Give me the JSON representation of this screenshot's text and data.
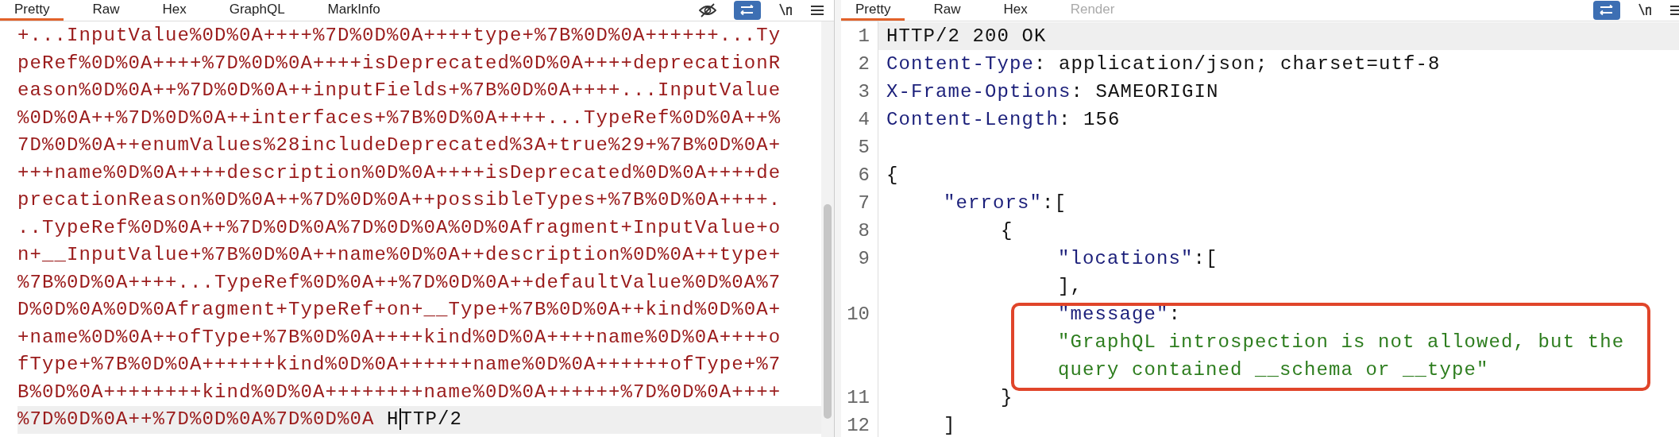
{
  "request_pane": {
    "tabs": [
      {
        "label": "Pretty",
        "selected": true
      },
      {
        "label": "Raw",
        "selected": false
      },
      {
        "label": "Hex",
        "selected": false
      },
      {
        "label": "GraphQL",
        "selected": false
      },
      {
        "label": "MarkInfo",
        "selected": false
      }
    ],
    "toolbar": {
      "wrap_on": true
    },
    "lines": [
      {
        "tokens": [
          {
            "kind": "encoded",
            "text": "+...InputValue%0D%0A++++%7D%0D%0A++++type+%7B%0D%0A++++++...Ty"
          }
        ]
      },
      {
        "tokens": [
          {
            "kind": "encoded",
            "text": "peRef%0D%0A++++%7D%0D%0A++++isDeprecated%0D%0A++++deprecationR"
          }
        ]
      },
      {
        "tokens": [
          {
            "kind": "encoded",
            "text": "eason%0D%0A++%7D%0D%0A++inputFields+%7B%0D%0A++++...InputValue"
          }
        ]
      },
      {
        "tokens": [
          {
            "kind": "encoded",
            "text": "%0D%0A++%7D%0D%0A++interfaces+%7B%0D%0A++++...TypeRef%0D%0A++%"
          }
        ]
      },
      {
        "tokens": [
          {
            "kind": "encoded",
            "text": "7D%0D%0A++enumValues%28includeDeprecated%3A+true%29+%7B%0D%0A+"
          }
        ]
      },
      {
        "tokens": [
          {
            "kind": "encoded",
            "text": "+++name%0D%0A++++description%0D%0A++++isDeprecated%0D%0A++++de"
          }
        ]
      },
      {
        "tokens": [
          {
            "kind": "encoded",
            "text": "precationReason%0D%0A++%7D%0D%0A++possibleTypes+%7B%0D%0A++++."
          }
        ]
      },
      {
        "tokens": [
          {
            "kind": "encoded",
            "text": "..TypeRef%0D%0A++%7D%0D%0A%7D%0D%0A%0D%0Afragment+InputValue+o"
          }
        ]
      },
      {
        "tokens": [
          {
            "kind": "encoded",
            "text": "n+__InputValue+%7B%0D%0A++name%0D%0A++description%0D%0A++type+"
          }
        ]
      },
      {
        "tokens": [
          {
            "kind": "encoded",
            "text": "%7B%0D%0A++++...TypeRef%0D%0A++%7D%0D%0A++defaultValue%0D%0A%7"
          }
        ]
      },
      {
        "tokens": [
          {
            "kind": "encoded",
            "text": "D%0D%0A%0D%0Afragment+TypeRef+on+__Type+%7B%0D%0A++kind%0D%0A+"
          }
        ]
      },
      {
        "tokens": [
          {
            "kind": "encoded",
            "text": "+name%0D%0A++ofType+%7B%0D%0A++++kind%0D%0A++++name%0D%0A++++o"
          }
        ]
      },
      {
        "tokens": [
          {
            "kind": "encoded",
            "text": "fType+%7B%0D%0A++++++kind%0D%0A++++++name%0D%0A++++++ofType+%7"
          }
        ]
      },
      {
        "tokens": [
          {
            "kind": "encoded",
            "text": "B%0D%0A++++++++kind%0D%0A++++++++name%0D%0A++++++%7D%0D%0A++++"
          }
        ]
      },
      {
        "highlighted": true,
        "tokens": [
          {
            "kind": "encoded",
            "text": "%7D%0D%0A++%7D%0D%0A%7D%0D%0A"
          },
          {
            "kind": "plain",
            "text": " H"
          },
          {
            "kind": "plain",
            "text": "TTP/2",
            "cursor_before": true
          }
        ]
      }
    ]
  },
  "response_pane": {
    "tabs": [
      {
        "label": "Pretty",
        "selected": true,
        "disabled": false
      },
      {
        "label": "Raw",
        "selected": false,
        "disabled": false
      },
      {
        "label": "Hex",
        "selected": false,
        "disabled": false
      },
      {
        "label": "Render",
        "selected": false,
        "disabled": true
      }
    ],
    "toolbar": {
      "wrap_on": true
    },
    "lines": [
      {
        "number": "1",
        "highlighted": true,
        "tokens": [
          {
            "kind": "plain",
            "text": "HTTP/2 200 OK"
          }
        ]
      },
      {
        "number": "2",
        "tokens": [
          {
            "kind": "key",
            "text": "Content-Type"
          },
          {
            "kind": "plain",
            "text": ": application/json; charset=utf-8"
          }
        ]
      },
      {
        "number": "3",
        "tokens": [
          {
            "kind": "key",
            "text": "X-Frame-Options"
          },
          {
            "kind": "plain",
            "text": ": SAMEORIGIN"
          }
        ]
      },
      {
        "number": "4",
        "tokens": [
          {
            "kind": "key",
            "text": "Content-Length"
          },
          {
            "kind": "plain",
            "text": ": 156"
          }
        ]
      },
      {
        "number": "5"
      },
      {
        "number": "6",
        "tokens": [
          {
            "kind": "plain",
            "text": "{"
          }
        ],
        "children": [
          {
            "number": "7",
            "tokens": [
              {
                "kind": "key",
                "text": "\"errors\""
              },
              {
                "kind": "plain",
                "text": ":["
              }
            ],
            "children": [
              {
                "number": "8",
                "tokens": [
                  {
                    "kind": "plain",
                    "text": "{"
                  }
                ],
                "children": [
                  {
                    "number": "9",
                    "tokens": [
                      {
                        "kind": "key",
                        "text": "\"locations\""
                      },
                      {
                        "kind": "plain",
                        "text": ":["
                      }
                    ]
                  },
                  {
                    "tokens": [
                      {
                        "kind": "plain",
                        "text": "],"
                      }
                    ]
                  },
                  {
                    "number": "10",
                    "boxed": true,
                    "tokens": [
                      {
                        "kind": "key",
                        "text": "\"message\""
                      },
                      {
                        "kind": "plain",
                        "text": ":"
                      }
                    ]
                  },
                  {
                    "boxed": true,
                    "tokens": [
                      {
                        "kind": "string",
                        "text": "\"GraphQL introspection is not allowed, but the"
                      }
                    ]
                  },
                  {
                    "boxed": true,
                    "tokens": [
                      {
                        "kind": "string",
                        "text": "query contained __schema or __type\""
                      }
                    ]
                  }
                ]
              },
              {
                "number": "11",
                "tokens": [
                  {
                    "kind": "plain",
                    "text": "}"
                  }
                ]
              }
            ]
          },
          {
            "number": "12",
            "tokens": [
              {
                "kind": "plain",
                "text": "]"
              }
            ]
          }
        ]
      }
    ]
  }
}
